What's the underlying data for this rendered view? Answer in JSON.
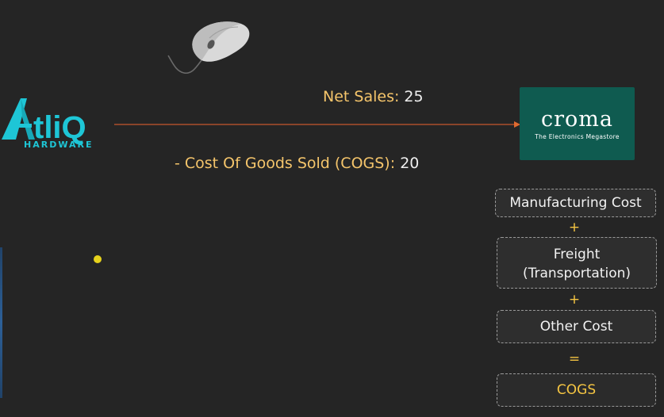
{
  "left_logo": {
    "wordmark": "AtliQ",
    "subtitle": "HARDWARE"
  },
  "right_logo": {
    "name": "croma",
    "tagline": "The Electronics Megastore"
  },
  "flow": {
    "net_sales_label": "Net Sales:",
    "net_sales_value": "25",
    "cogs_label": "- Cost Of Goods Sold (COGS):",
    "cogs_value": "20"
  },
  "breakdown": {
    "item1": "Manufacturing Cost",
    "op1": "+",
    "item2_line1": "Freight",
    "item2_line2": "(Transportation)",
    "op2": "+",
    "item3": "Other Cost",
    "op3": "=",
    "result": "COGS"
  },
  "colors": {
    "background": "#252525",
    "label_gold": "#f5c56b",
    "accent_yellow": "#f5c542",
    "croma_green": "#0f5b50",
    "atliq_teal": "#1ec6d6",
    "arrow": "#c8582d"
  }
}
